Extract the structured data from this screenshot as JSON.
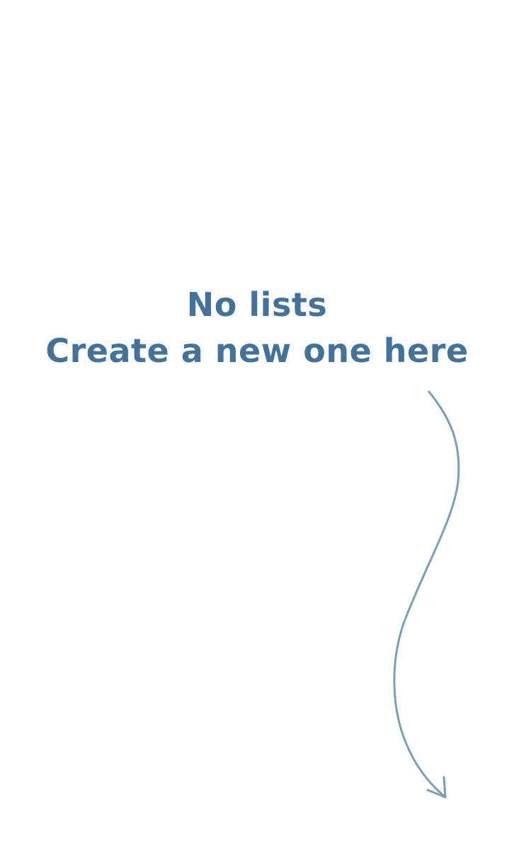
{
  "empty_state": {
    "title": "No lists",
    "subtitle": "Create a new one here"
  },
  "colors": {
    "text": "#43739a",
    "arrow": "#7a9fbb",
    "background": "#ffffff"
  },
  "icons": {
    "arrow": "curved-arrow-down-icon"
  }
}
